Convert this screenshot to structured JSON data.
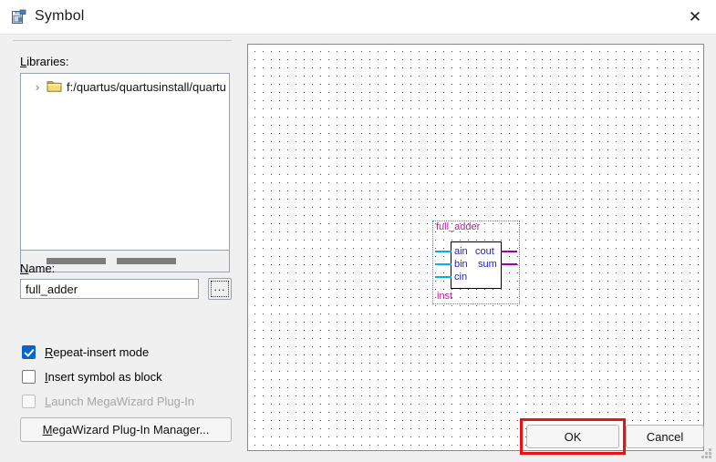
{
  "window": {
    "title": "Symbol",
    "icon": "symbol-document-icon",
    "close_label": "✕"
  },
  "left_panel": {
    "libraries_label": "Libraries:",
    "libraries_accel": "L",
    "libraries_rest": "ibraries:",
    "tree": {
      "expand_arrow": "›",
      "items": [
        {
          "icon": "folder-icon",
          "label": "f:/quartus/quartusinstall/quartu"
        }
      ]
    },
    "name_label": "Name:",
    "name_accel": "N",
    "name_rest": "ame:",
    "name_value": "full_adder",
    "name_placeholder": "",
    "browse_label": "...",
    "checkboxes": [
      {
        "label": "Repeat-insert mode",
        "checked": true,
        "enabled": true,
        "accel": "R"
      },
      {
        "label": "Insert symbol as block",
        "checked": false,
        "enabled": true,
        "accel": "I"
      },
      {
        "label": "Launch MegaWizard Plug-In",
        "checked": false,
        "enabled": false,
        "accel": "L"
      }
    ],
    "megawizard_button": "MegaWizard Plug-In Manager..."
  },
  "preview": {
    "symbol_name": "full_adder",
    "instance_name": "inst",
    "inputs": [
      "ain",
      "bin",
      "cin"
    ],
    "outputs": [
      "cout",
      "sum"
    ],
    "colors": {
      "symbol_name": "#b0239c",
      "port_label": "#1a1ae0",
      "input_pin": "#00b0f0",
      "output_pin": "#a000a0",
      "selection": "#00b0b0",
      "body_outline": "#000000"
    }
  },
  "footer": {
    "ok_label": "OK",
    "cancel_label": "Cancel",
    "highlight_color": "#ee1111"
  }
}
